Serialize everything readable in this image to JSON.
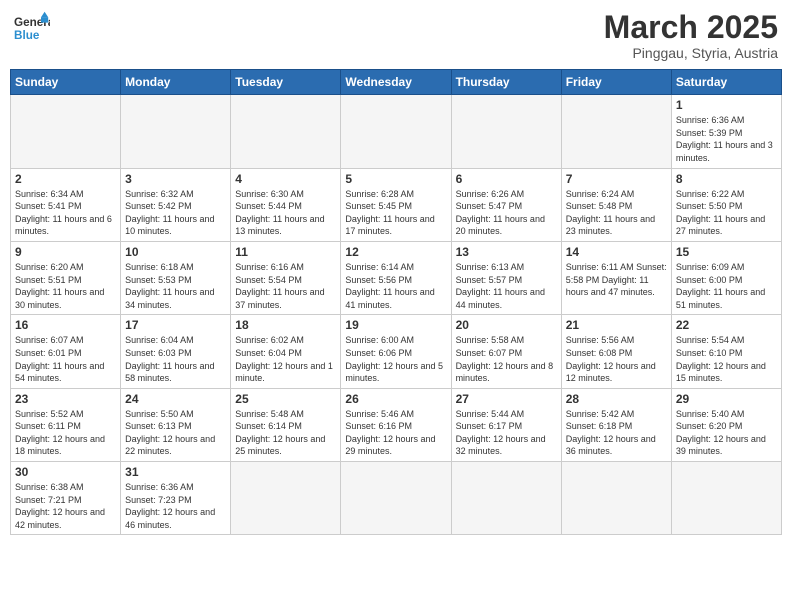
{
  "header": {
    "logo_general": "General",
    "logo_blue": "Blue",
    "month_title": "March 2025",
    "location": "Pinggau, Styria, Austria"
  },
  "weekdays": [
    "Sunday",
    "Monday",
    "Tuesday",
    "Wednesday",
    "Thursday",
    "Friday",
    "Saturday"
  ],
  "weeks": [
    [
      {
        "day": "",
        "info": ""
      },
      {
        "day": "",
        "info": ""
      },
      {
        "day": "",
        "info": ""
      },
      {
        "day": "",
        "info": ""
      },
      {
        "day": "",
        "info": ""
      },
      {
        "day": "",
        "info": ""
      },
      {
        "day": "1",
        "info": "Sunrise: 6:36 AM\nSunset: 5:39 PM\nDaylight: 11 hours and 3 minutes."
      }
    ],
    [
      {
        "day": "2",
        "info": "Sunrise: 6:34 AM\nSunset: 5:41 PM\nDaylight: 11 hours and 6 minutes."
      },
      {
        "day": "3",
        "info": "Sunrise: 6:32 AM\nSunset: 5:42 PM\nDaylight: 11 hours and 10 minutes."
      },
      {
        "day": "4",
        "info": "Sunrise: 6:30 AM\nSunset: 5:44 PM\nDaylight: 11 hours and 13 minutes."
      },
      {
        "day": "5",
        "info": "Sunrise: 6:28 AM\nSunset: 5:45 PM\nDaylight: 11 hours and 17 minutes."
      },
      {
        "day": "6",
        "info": "Sunrise: 6:26 AM\nSunset: 5:47 PM\nDaylight: 11 hours and 20 minutes."
      },
      {
        "day": "7",
        "info": "Sunrise: 6:24 AM\nSunset: 5:48 PM\nDaylight: 11 hours and 23 minutes."
      },
      {
        "day": "8",
        "info": "Sunrise: 6:22 AM\nSunset: 5:50 PM\nDaylight: 11 hours and 27 minutes."
      }
    ],
    [
      {
        "day": "9",
        "info": "Sunrise: 6:20 AM\nSunset: 5:51 PM\nDaylight: 11 hours and 30 minutes."
      },
      {
        "day": "10",
        "info": "Sunrise: 6:18 AM\nSunset: 5:53 PM\nDaylight: 11 hours and 34 minutes."
      },
      {
        "day": "11",
        "info": "Sunrise: 6:16 AM\nSunset: 5:54 PM\nDaylight: 11 hours and 37 minutes."
      },
      {
        "day": "12",
        "info": "Sunrise: 6:14 AM\nSunset: 5:56 PM\nDaylight: 11 hours and 41 minutes."
      },
      {
        "day": "13",
        "info": "Sunrise: 6:13 AM\nSunset: 5:57 PM\nDaylight: 11 hours and 44 minutes."
      },
      {
        "day": "14",
        "info": "Sunrise: 6:11 AM\nSunset: 5:58 PM\nDaylight: 11 hours and 47 minutes."
      },
      {
        "day": "15",
        "info": "Sunrise: 6:09 AM\nSunset: 6:00 PM\nDaylight: 11 hours and 51 minutes."
      }
    ],
    [
      {
        "day": "16",
        "info": "Sunrise: 6:07 AM\nSunset: 6:01 PM\nDaylight: 11 hours and 54 minutes."
      },
      {
        "day": "17",
        "info": "Sunrise: 6:04 AM\nSunset: 6:03 PM\nDaylight: 11 hours and 58 minutes."
      },
      {
        "day": "18",
        "info": "Sunrise: 6:02 AM\nSunset: 6:04 PM\nDaylight: 12 hours and 1 minute."
      },
      {
        "day": "19",
        "info": "Sunrise: 6:00 AM\nSunset: 6:06 PM\nDaylight: 12 hours and 5 minutes."
      },
      {
        "day": "20",
        "info": "Sunrise: 5:58 AM\nSunset: 6:07 PM\nDaylight: 12 hours and 8 minutes."
      },
      {
        "day": "21",
        "info": "Sunrise: 5:56 AM\nSunset: 6:08 PM\nDaylight: 12 hours and 12 minutes."
      },
      {
        "day": "22",
        "info": "Sunrise: 5:54 AM\nSunset: 6:10 PM\nDaylight: 12 hours and 15 minutes."
      }
    ],
    [
      {
        "day": "23",
        "info": "Sunrise: 5:52 AM\nSunset: 6:11 PM\nDaylight: 12 hours and 18 minutes."
      },
      {
        "day": "24",
        "info": "Sunrise: 5:50 AM\nSunset: 6:13 PM\nDaylight: 12 hours and 22 minutes."
      },
      {
        "day": "25",
        "info": "Sunrise: 5:48 AM\nSunset: 6:14 PM\nDaylight: 12 hours and 25 minutes."
      },
      {
        "day": "26",
        "info": "Sunrise: 5:46 AM\nSunset: 6:16 PM\nDaylight: 12 hours and 29 minutes."
      },
      {
        "day": "27",
        "info": "Sunrise: 5:44 AM\nSunset: 6:17 PM\nDaylight: 12 hours and 32 minutes."
      },
      {
        "day": "28",
        "info": "Sunrise: 5:42 AM\nSunset: 6:18 PM\nDaylight: 12 hours and 36 minutes."
      },
      {
        "day": "29",
        "info": "Sunrise: 5:40 AM\nSunset: 6:20 PM\nDaylight: 12 hours and 39 minutes."
      }
    ],
    [
      {
        "day": "30",
        "info": "Sunrise: 6:38 AM\nSunset: 7:21 PM\nDaylight: 12 hours and 42 minutes."
      },
      {
        "day": "31",
        "info": "Sunrise: 6:36 AM\nSunset: 7:23 PM\nDaylight: 12 hours and 46 minutes."
      },
      {
        "day": "",
        "info": ""
      },
      {
        "day": "",
        "info": ""
      },
      {
        "day": "",
        "info": ""
      },
      {
        "day": "",
        "info": ""
      },
      {
        "day": "",
        "info": ""
      }
    ]
  ]
}
